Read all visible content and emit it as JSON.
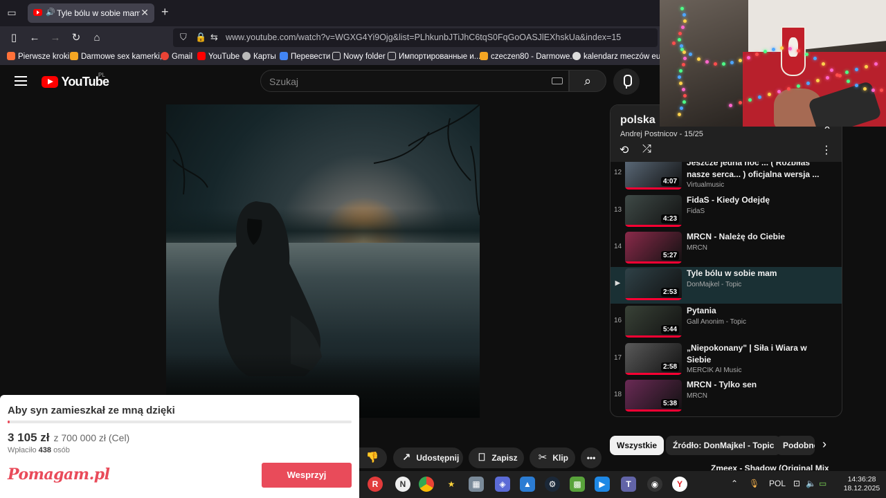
{
  "browser": {
    "tab_title": "Tyle bólu w sobie mam - YouTube",
    "url": "www.youtube.com/watch?v=WGXG4Yi9Ojg&list=PLhkunbJTiJhC6tqS0FqGoOASJlEXhskUa&index=15",
    "bookmarks": [
      {
        "label": "Pierwsze kroki",
        "color": "#ff7139"
      },
      {
        "label": "Darmowe sex kamerki,...",
        "color": "#f5a623"
      },
      {
        "label": "Gmail",
        "color": "#ea4335"
      },
      {
        "label": "YouTube",
        "color": "#ff0000"
      },
      {
        "label": "Карты",
        "color": "#bbbbbb"
      },
      {
        "label": "Перевести",
        "color": "#4285f4"
      },
      {
        "label": "Nowy folder",
        "color": "#dddddd"
      },
      {
        "label": "Импортированные и...",
        "color": "#dddddd"
      },
      {
        "label": "czeczen80 - Darmowe...",
        "color": "#f5a623"
      },
      {
        "label": "kalendarz meczów eur...",
        "color": "#dddddd"
      }
    ]
  },
  "youtube": {
    "logo_text": "YouTube",
    "country": "PL",
    "search_placeholder": "Szukaj"
  },
  "playlist": {
    "title": "polska",
    "owner": "Andrej Postnicov",
    "position": "15/25",
    "items": [
      {
        "index": "12",
        "title": "Jeszcze jedna noc ... ( Rozbiłaś nasze serca... ) oficjalna wersja ...",
        "author": "Virtualmusic",
        "duration": "4:07",
        "thumb_color": "#5c6b7a",
        "active": false
      },
      {
        "index": "13",
        "title": "FidaS - Kiedy Odejdę",
        "author": "FidaS",
        "duration": "4:23",
        "thumb_color": "#3f4a47",
        "active": false
      },
      {
        "index": "14",
        "title": "MRCN - Należę do Ciebie",
        "author": "MRCN",
        "duration": "5:27",
        "thumb_color": "#8a2a4a",
        "active": false
      },
      {
        "index": "▶",
        "title": "Tyle bólu w sobie mam",
        "author": "DonMajkel - Topic",
        "duration": "2:53",
        "thumb_color": "#2f4147",
        "active": true
      },
      {
        "index": "16",
        "title": "Pytania",
        "author": "Gall Anonim - Topic",
        "duration": "5:44",
        "thumb_color": "#394237",
        "active": false
      },
      {
        "index": "17",
        "title": "„Niepokonany\" | Siła i Wiara w Siebie",
        "author": "MERCIK AI Music",
        "duration": "2:58",
        "thumb_color": "#5a5a5a",
        "active": false
      },
      {
        "index": "18",
        "title": "MRCN - Tylko sen",
        "author": "MRCN",
        "duration": "5:38",
        "thumb_color": "#6a2a55",
        "active": false
      }
    ]
  },
  "actions": {
    "share": "Udostępnij",
    "save": "Zapisz",
    "clip": "Klip"
  },
  "chips": [
    "Wszystkie",
    "Źródło: DonMajkel - Topic",
    "Podobne"
  ],
  "next_video_partial": "Zmeex - Shadow (Original Mix)",
  "donation": {
    "title": "Aby syn zamieszkał ze mną dzięki",
    "raised": "3 105 zł",
    "goal": "z 700 000 zł (Cel)",
    "paid_prefix": "Wpłaciło",
    "paid_count": "438",
    "paid_suffix": "osób",
    "progress_fraction": 0.0044,
    "logo": "Pomagam.pl",
    "button": "Wesprzyj"
  },
  "taskbar": {
    "language": "POL",
    "time": "14:36:28",
    "date": "18.12.2025"
  }
}
